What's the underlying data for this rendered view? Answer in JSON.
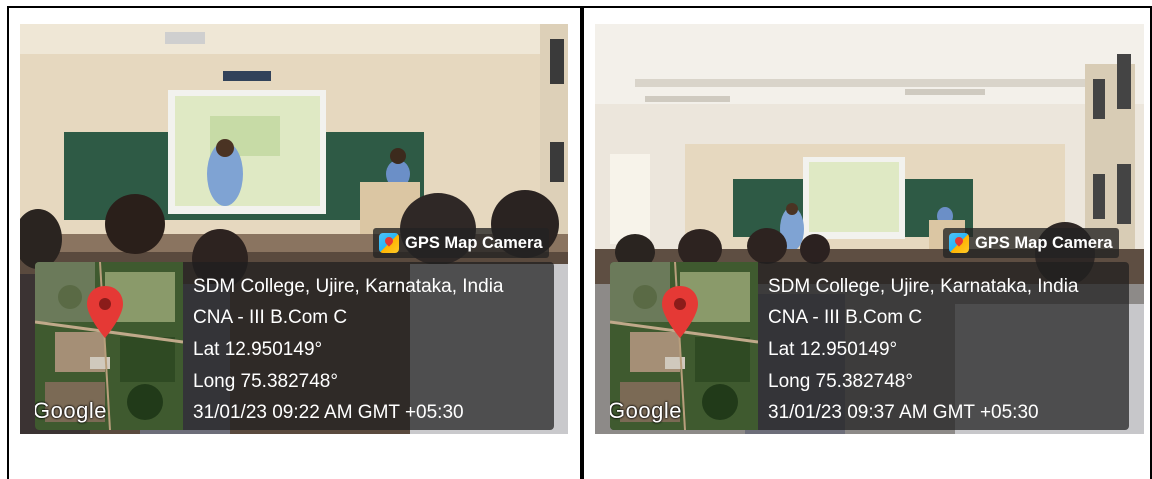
{
  "panels": [
    {
      "badge": "GPS Map Camera",
      "map_logo": "Google",
      "location": "SDM College, Ujire, Karnataka, India",
      "caption": "CNA - III B.Com C",
      "lat": "Lat 12.950149°",
      "long": "Long 75.382748°",
      "datetime": "31/01/23 09:22 AM GMT +05:30"
    },
    {
      "badge": "GPS Map Camera",
      "map_logo": "Google",
      "location": "SDM College, Ujire, Karnataka, India",
      "caption": "CNA - III B.Com C",
      "lat": "Lat 12.950149°",
      "long": "Long 75.382748°",
      "datetime": "31/01/23 09:37 AM GMT +05:30"
    }
  ],
  "colors": {
    "map_pin": "#e53935",
    "chalkboard": "#2e5a45",
    "wall": "#e9dcc6"
  }
}
